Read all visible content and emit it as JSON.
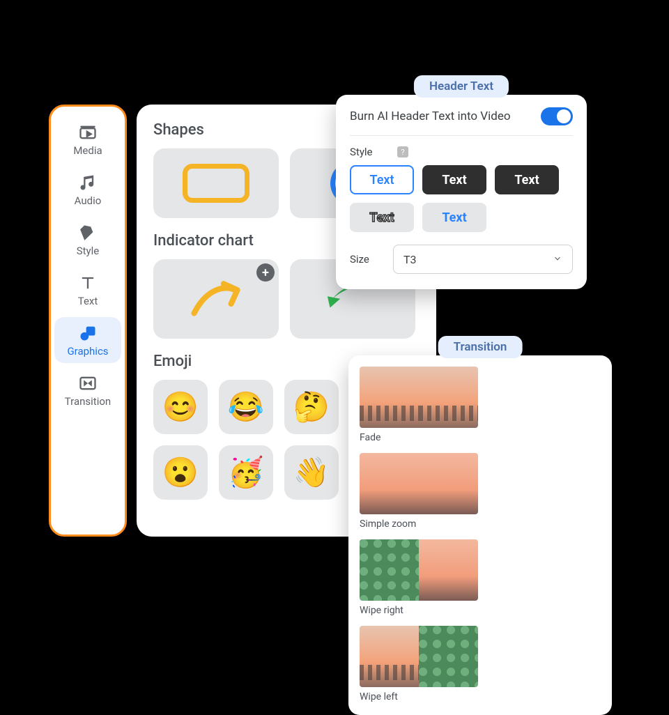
{
  "sidebar": {
    "items": [
      {
        "label": "Media",
        "active": false
      },
      {
        "label": "Audio",
        "active": false
      },
      {
        "label": "Style",
        "active": false
      },
      {
        "label": "Text",
        "active": false
      },
      {
        "label": "Graphics",
        "active": true
      },
      {
        "label": "Transition",
        "active": false
      }
    ]
  },
  "graphics_panel": {
    "sections": {
      "shapes": {
        "title": "Shapes"
      },
      "indicator": {
        "title": "Indicator chart"
      },
      "emoji": {
        "title": "Emoji",
        "items": [
          "😊",
          "😂",
          "🤔",
          "😮",
          "🥳",
          "👋"
        ]
      }
    }
  },
  "header_panel": {
    "tag": "Header Text",
    "toggle_label": "Burn AI Header Text into Video",
    "toggle_on": true,
    "style_label": "Style",
    "style_chip_text": "Text",
    "style_selected_index": 0,
    "size_label": "Size",
    "size_value": "T3"
  },
  "transition_panel": {
    "tag": "Transition",
    "items": [
      {
        "label": "Fade"
      },
      {
        "label": "Simple zoom"
      },
      {
        "label": "Wipe right"
      },
      {
        "label": "Wipe left"
      }
    ]
  }
}
